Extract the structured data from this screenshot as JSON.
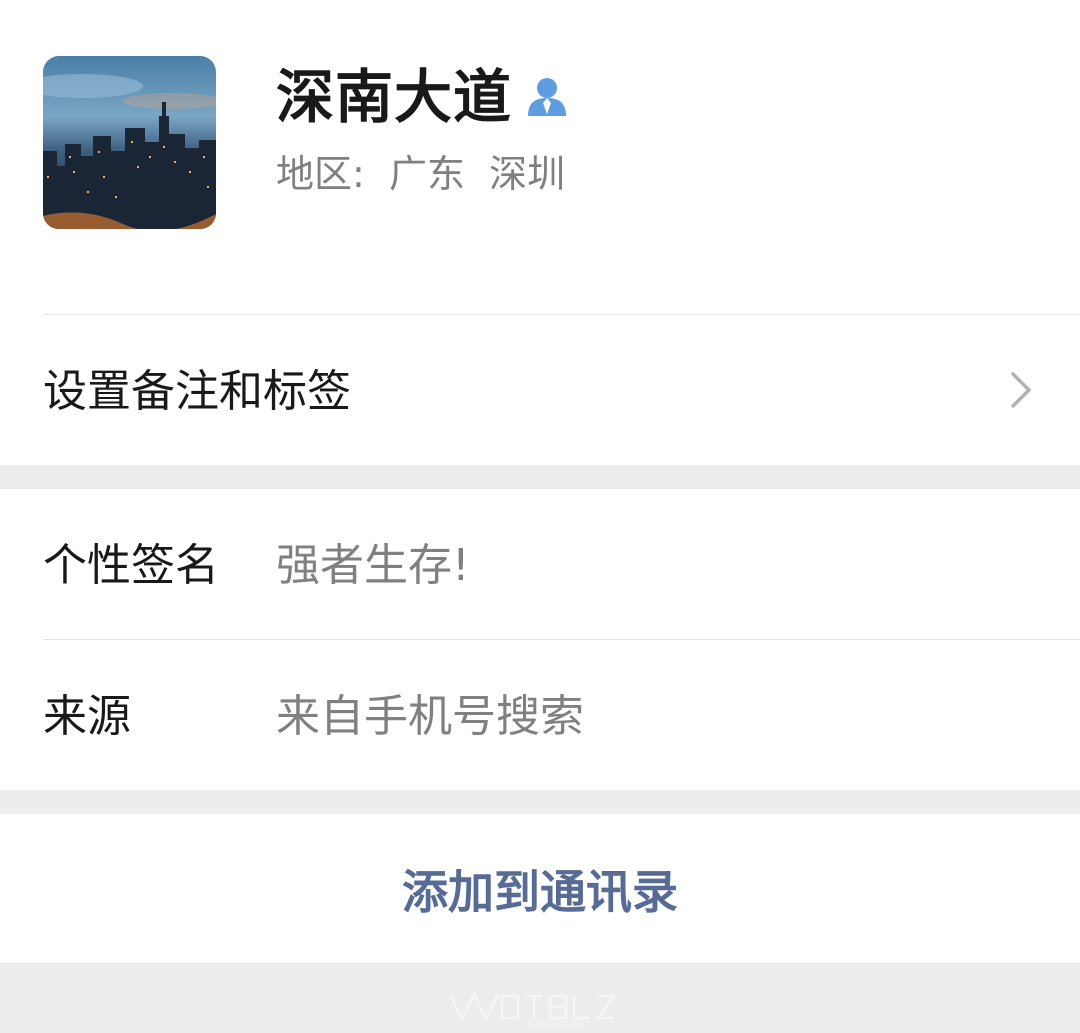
{
  "profile": {
    "name": "深南大道",
    "region": "地区:  广东  深圳",
    "avatar_description": "city-night-skyline-avatar"
  },
  "rows": {
    "remark_label": "设置备注和标签",
    "signature_label": "个性签名",
    "signature_value": "强者生存!",
    "source_label": "来源",
    "source_value": "来自手机号搜索"
  },
  "actions": {
    "add_to_contacts": "添加到通讯录"
  },
  "watermark": {
    "text": "GDMM.COM"
  },
  "colors": {
    "background": "#ededed",
    "card": "#ffffff",
    "link": "#576b95",
    "secondary_text": "#808080",
    "person_icon": "#5d9de0"
  },
  "icons": {
    "person": "person-icon",
    "chevron": "chevron-right-icon"
  }
}
